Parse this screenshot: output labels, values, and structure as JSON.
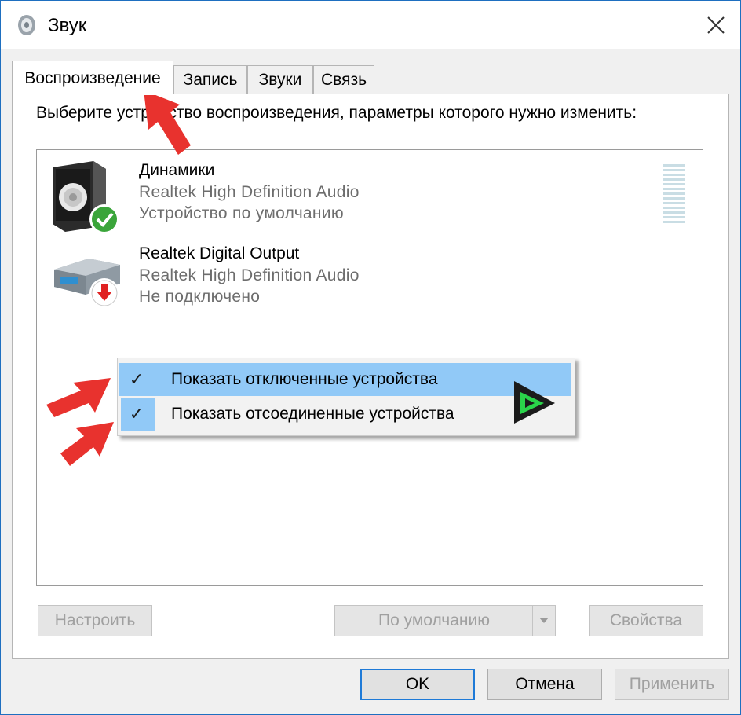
{
  "window": {
    "title": "Звук",
    "close_icon": "close-icon"
  },
  "tabs": [
    {
      "label": "Воспроизведение",
      "active": true
    },
    {
      "label": "Запись"
    },
    {
      "label": "Звуки"
    },
    {
      "label": "Связь"
    }
  ],
  "instruction": "Выберите устройство воспроизведения, параметры которого нужно изменить:",
  "devices": [
    {
      "name": "Динамики",
      "driver": "Realtek High Definition Audio",
      "status": "Устройство по умолчанию",
      "icon": "speaker-icon",
      "badge": "default-check-badge"
    },
    {
      "name": "Realtek Digital Output",
      "driver": "Realtek High Definition Audio",
      "status": "Не подключено",
      "icon": "digital-output-icon",
      "badge": "disconnected-arrow-badge"
    }
  ],
  "context_menu": {
    "items": [
      {
        "label": "Показать отключенные устройства",
        "checked": true,
        "highlighted": true
      },
      {
        "label": "Показать отсоединенные устройства",
        "checked": true,
        "highlighted": false
      }
    ]
  },
  "buttons": {
    "configure": "Настроить",
    "set_default": "По умолчанию",
    "properties": "Свойства",
    "ok": "OK",
    "cancel": "Отмена",
    "apply": "Применить"
  },
  "colors": {
    "accent": "#1e7ad7",
    "menu_highlight": "#91c9f7",
    "annotation_arrow": "#e8322e",
    "check_badge": "#3aa53a"
  }
}
